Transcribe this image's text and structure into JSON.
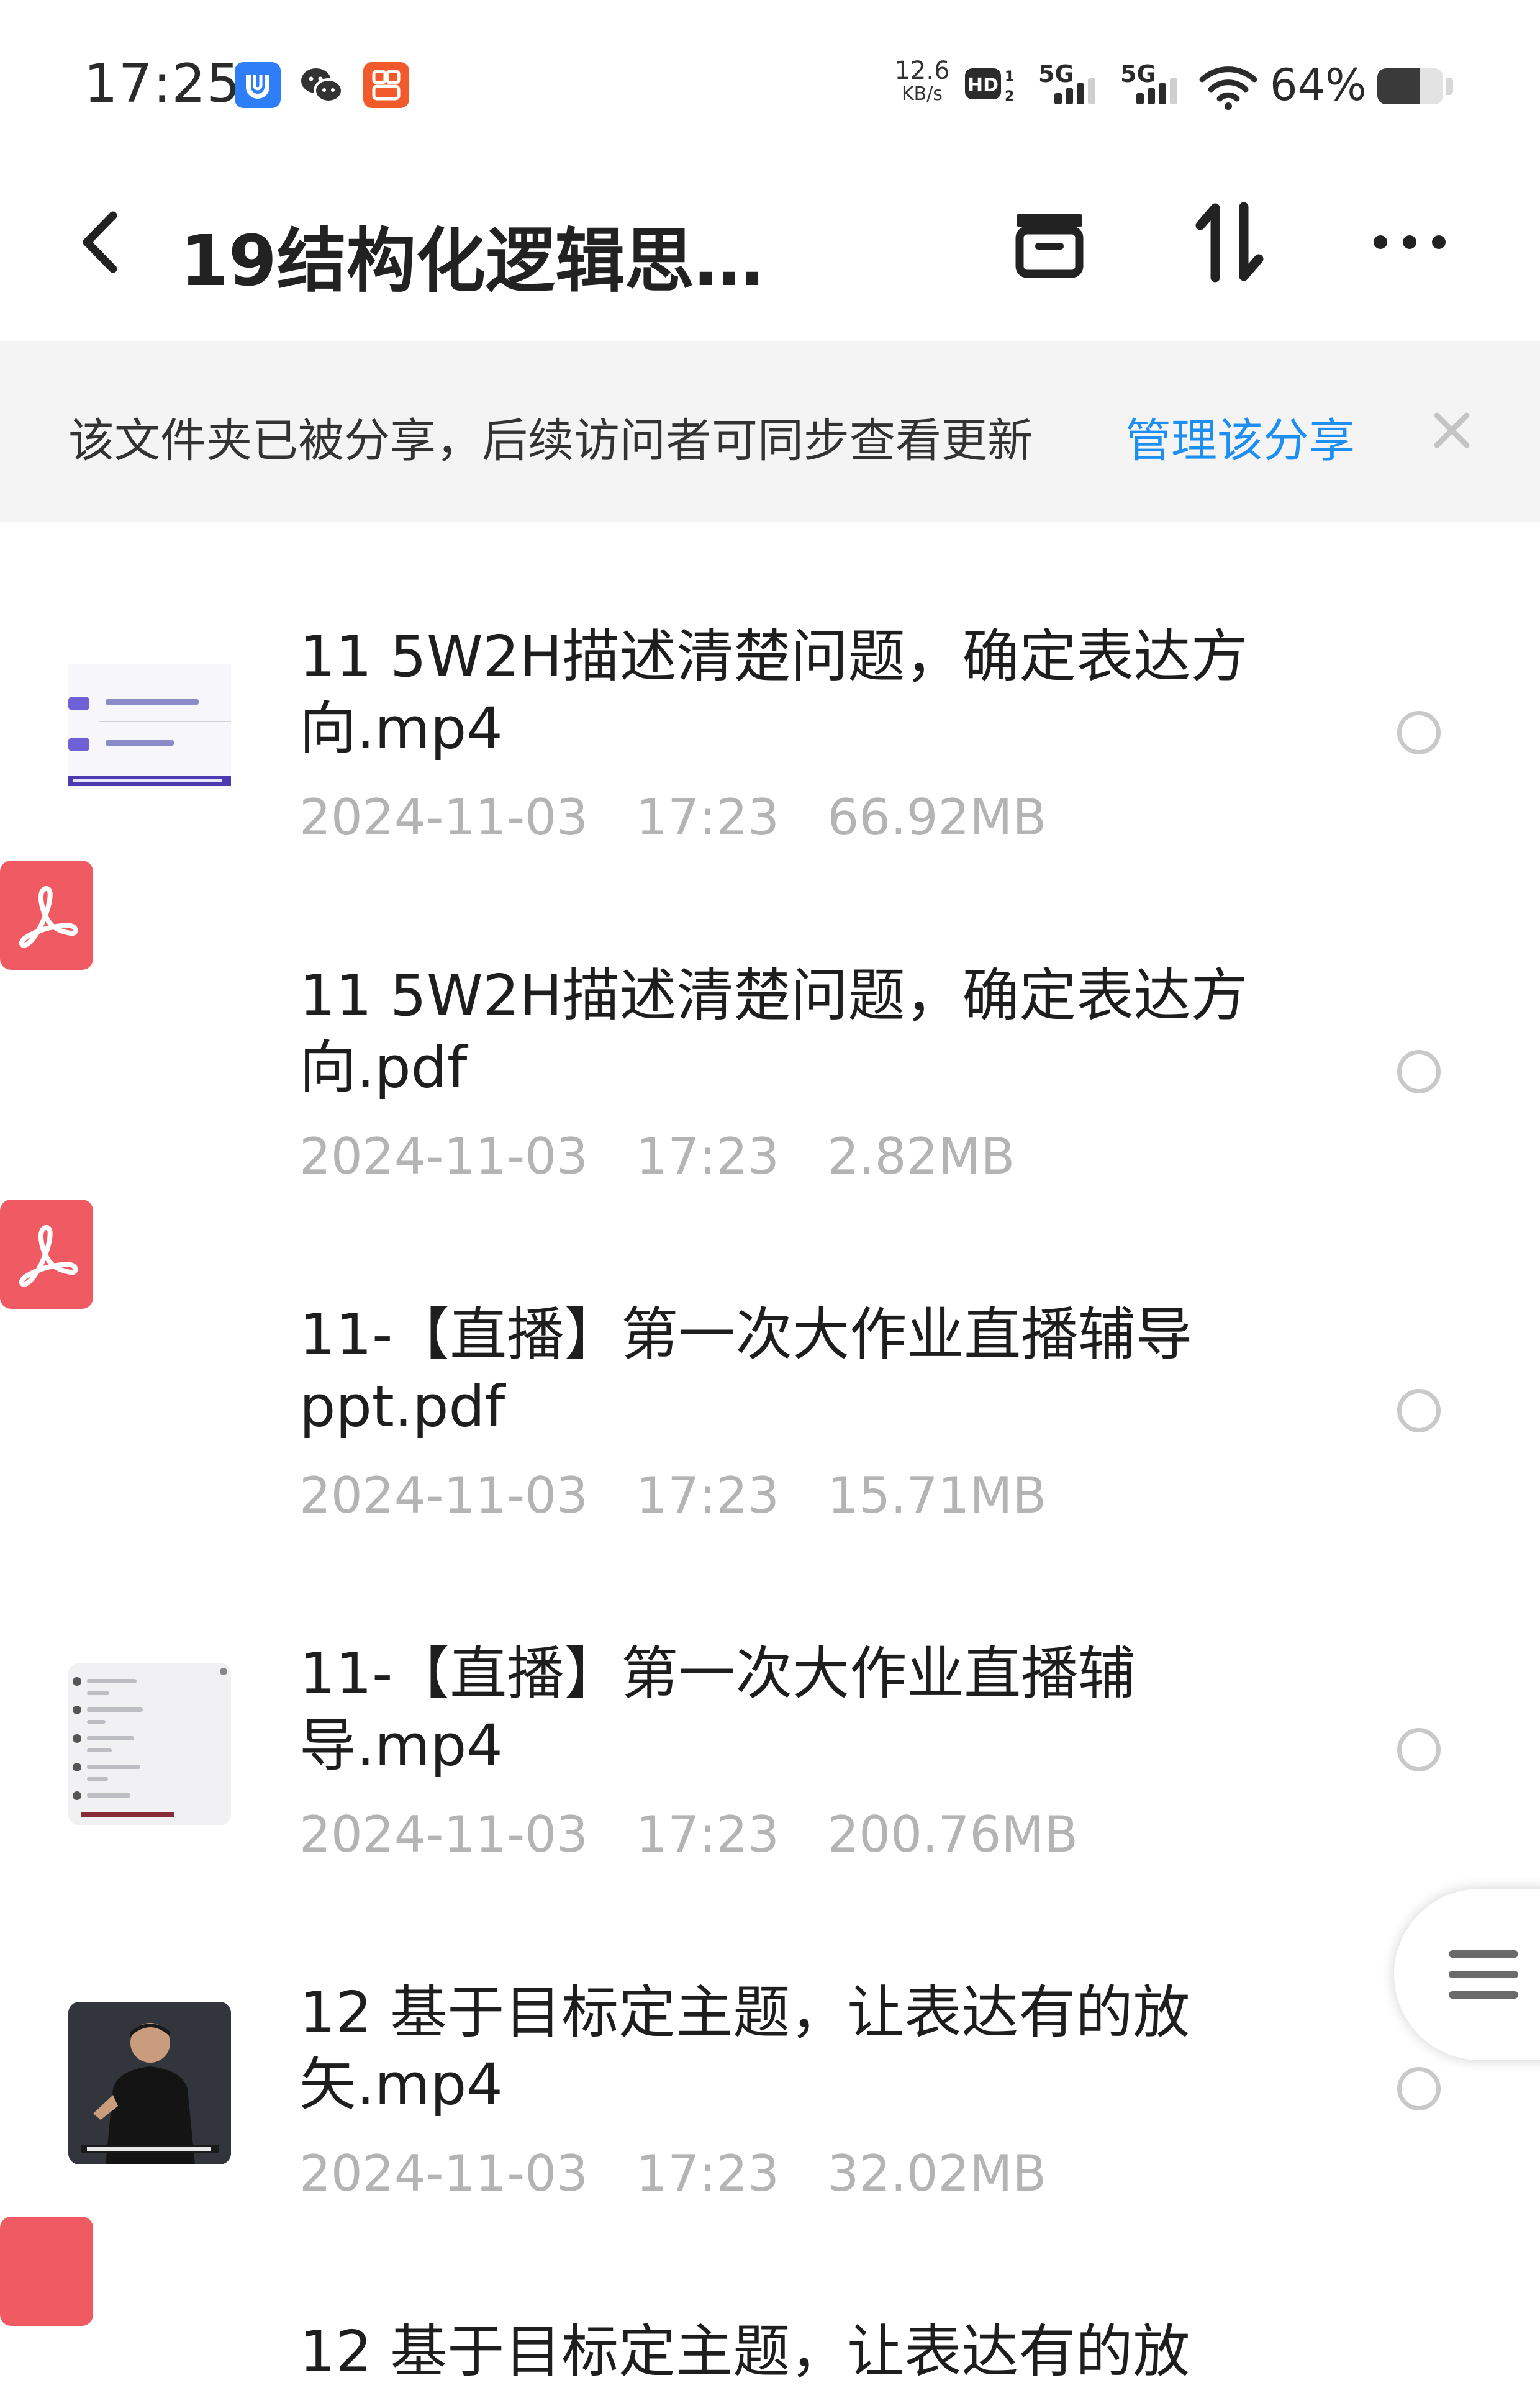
{
  "status_bar": {
    "time": "17:25",
    "net_speed_value": "12.6",
    "net_speed_unit": "KB/s",
    "battery_text": "64%",
    "battery_level": 0.64,
    "icons": [
      "app-notification-icon",
      "wechat-icon",
      "app-notification-icon",
      "hd-icon",
      "signal-5g-icon",
      "signal-5g-icon",
      "wifi-icon",
      "battery-icon"
    ]
  },
  "header": {
    "title": "19结构化逻辑思维…",
    "back_icon": "chevron-left-icon",
    "actions": [
      "archive-icon",
      "sort-icon",
      "more-icon"
    ]
  },
  "share_banner": {
    "message": "该文件夹已被分享，后续访问者可同步查看更新",
    "manage_link": "管理该分享",
    "close_icon": "close-icon"
  },
  "colors": {
    "accent": "#1d8ff2",
    "pdf": "#f05a62",
    "meta_text": "#b4b4b4",
    "banner_bg": "#f4f4f4"
  },
  "files": [
    {
      "name": "11 5W2H描述清楚问题，确定表达方向.mp4",
      "date": "2024-11-03",
      "time": "17:23",
      "size": "66.92MB",
      "type": "video"
    },
    {
      "name": "11 5W2H描述清楚问题，确定表达方向.pdf",
      "date": "2024-11-03",
      "time": "17:23",
      "size": "2.82MB",
      "type": "pdf"
    },
    {
      "name": "11-【直播】第一次大作业直播辅导ppt.pdf",
      "date": "2024-11-03",
      "time": "17:23",
      "size": "15.71MB",
      "type": "pdf"
    },
    {
      "name": "11-【直播】第一次大作业直播辅导.mp4",
      "date": "2024-11-03",
      "time": "17:23",
      "size": "200.76MB",
      "type": "video"
    },
    {
      "name": "12 基于目标定主题，让表达有的放矢.mp4",
      "date": "2024-11-03",
      "time": "17:23",
      "size": "32.02MB",
      "type": "video"
    },
    {
      "name": "12 基于目标定主题，让表达有的放",
      "type": "pdf"
    }
  ],
  "floating_menu_icon": "menu-icon"
}
